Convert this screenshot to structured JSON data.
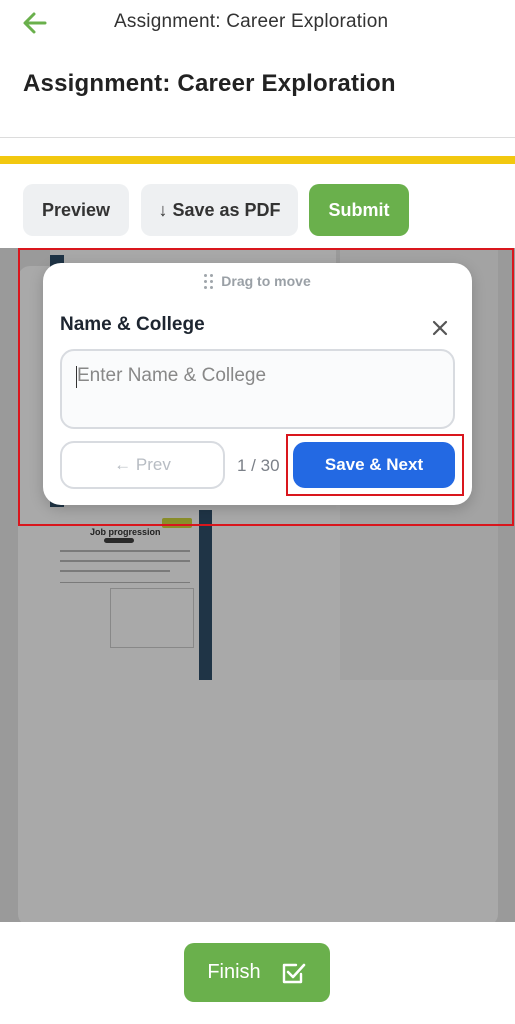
{
  "appbar": {
    "title": "Assignment: Career Exploration"
  },
  "page": {
    "title": "Assignment: Career Exploration"
  },
  "toolbar": {
    "preview_label": "Preview",
    "pdf_label": "↓ Save as PDF",
    "submit_label": "Submit"
  },
  "document": {
    "job_title": "Job progression"
  },
  "card": {
    "drag_label": "Drag to move",
    "field_label": "Name & College",
    "placeholder": "Enter Name & College",
    "value": "",
    "prev_label": "← Prev",
    "counter": "1 / 30",
    "next_label": "Save & Next"
  },
  "footer": {
    "finish_label": "Finish"
  },
  "colors": {
    "accent_green": "#6ab04c",
    "primary_blue": "#2369e3",
    "highlight_red": "#d9161d",
    "stripe_yellow": "#f2c80f"
  }
}
